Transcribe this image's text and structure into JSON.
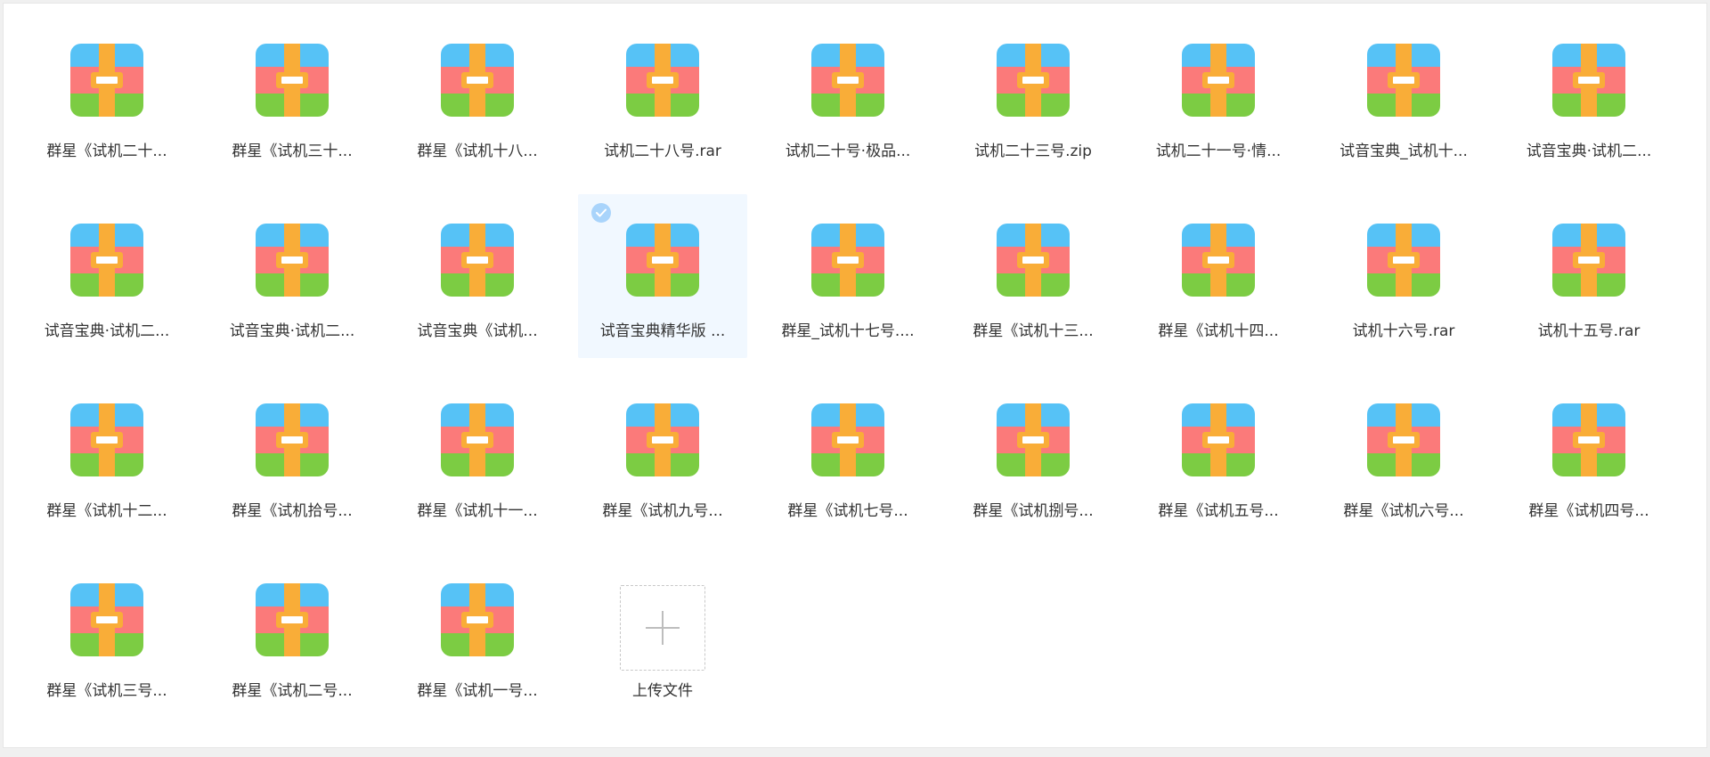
{
  "colors": {
    "archive_blue": "#56c2f6",
    "archive_red": "#fb7a7a",
    "archive_green": "#7ccc43",
    "archive_strap": "#f9ad38",
    "archive_buckle": "#ffffff",
    "selected_bg": "#f1f8ff",
    "check_bg": "#a9d4fb",
    "text": "#333333"
  },
  "files": [
    {
      "name": "群星《试机二十..."
    },
    {
      "name": "群星《试机三十..."
    },
    {
      "name": "群星《试机十八..."
    },
    {
      "name": "试机二十八号.rar"
    },
    {
      "name": "试机二十号·极品..."
    },
    {
      "name": "试机二十三号.zip"
    },
    {
      "name": "试机二十一号·情..."
    },
    {
      "name": "试音宝典_试机十..."
    },
    {
      "name": "试音宝典·试机二..."
    },
    {
      "name": "试音宝典·试机二..."
    },
    {
      "name": "试音宝典·试机二..."
    },
    {
      "name": "试音宝典《试机..."
    },
    {
      "name": "试音宝典精华版 ...",
      "selected": true
    },
    {
      "name": "群星_试机十七号...."
    },
    {
      "name": "群星《试机十三..."
    },
    {
      "name": "群星《试机十四..."
    },
    {
      "name": "试机十六号.rar"
    },
    {
      "name": "试机十五号.rar"
    },
    {
      "name": "群星《试机十二..."
    },
    {
      "name": "群星《试机拾号..."
    },
    {
      "name": "群星《试机十一..."
    },
    {
      "name": "群星《试机九号..."
    },
    {
      "name": "群星《试机七号..."
    },
    {
      "name": "群星《试机捌号..."
    },
    {
      "name": "群星《试机五号..."
    },
    {
      "name": "群星《试机六号..."
    },
    {
      "name": "群星《试机四号..."
    },
    {
      "name": "群星《试机三号..."
    },
    {
      "name": "群星《试机二号..."
    },
    {
      "name": "群星《试机一号..."
    }
  ],
  "upload": {
    "label": "上传文件",
    "icon": "plus-icon"
  },
  "file_icon": "archive-icon",
  "selection_icon": "check-circle-icon"
}
